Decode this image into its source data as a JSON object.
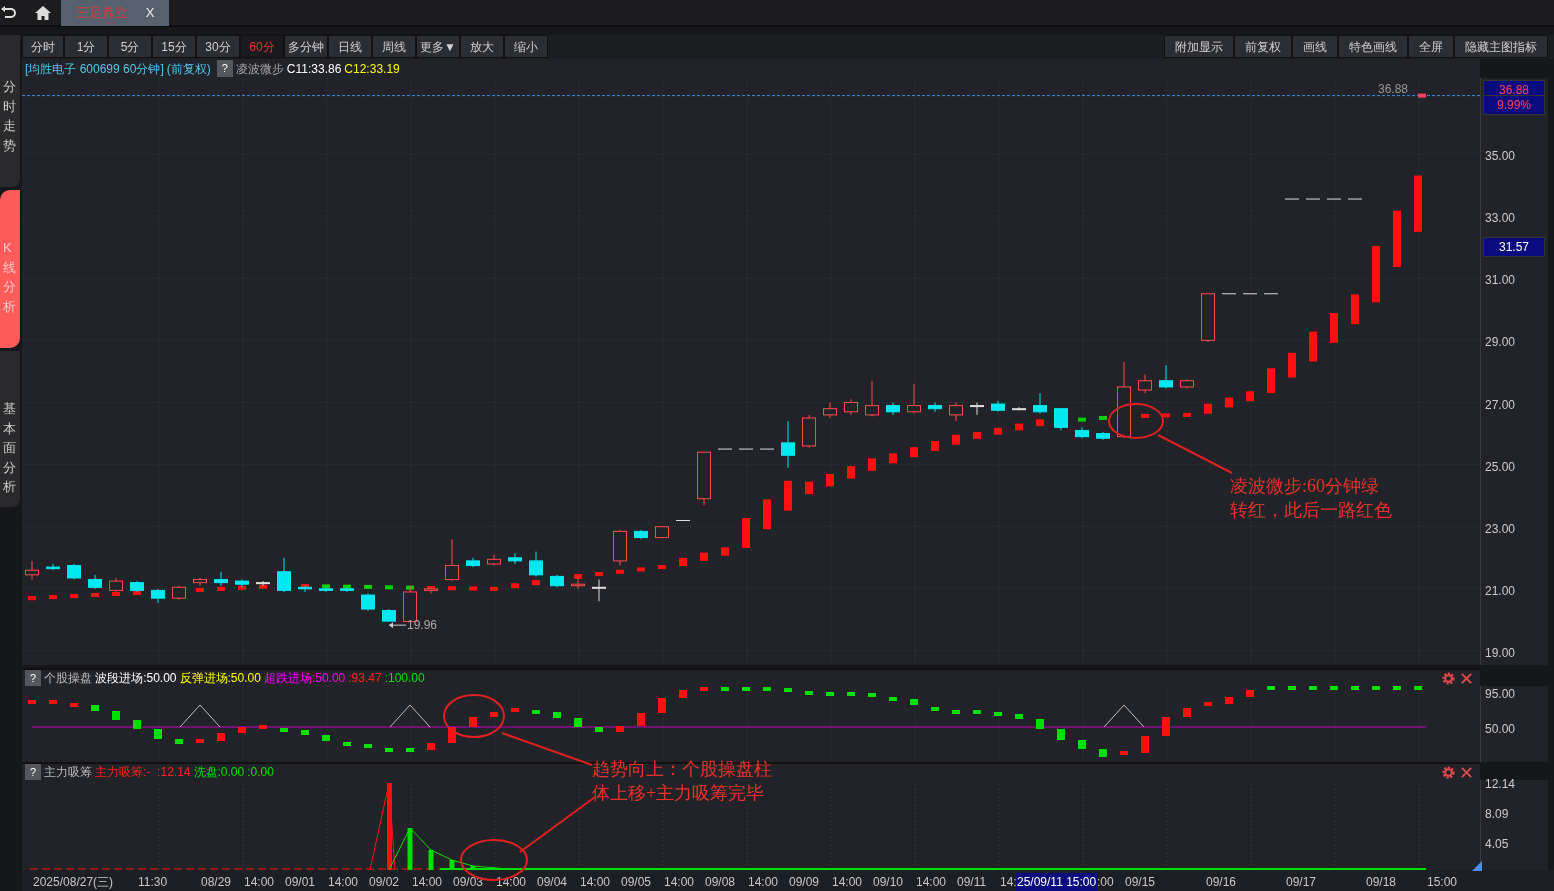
{
  "top_bar": {
    "tabs": [
      {
        "label": "三足鼎立",
        "close": "X",
        "selected": true
      }
    ]
  },
  "sidebar": {
    "items": [
      {
        "label": "分时走势",
        "selected": false
      },
      {
        "label": "K线分析",
        "selected": true
      },
      {
        "label": "基本面分析",
        "selected": false
      }
    ]
  },
  "toolbar": {
    "buttons": [
      {
        "label": "分时",
        "selected": false
      },
      {
        "label": "1分",
        "selected": false
      },
      {
        "label": "5分",
        "selected": false
      },
      {
        "label": "15分",
        "selected": false
      },
      {
        "label": "30分",
        "selected": false
      },
      {
        "label": "60分",
        "selected": true
      },
      {
        "label": "多分钟",
        "selected": false
      },
      {
        "label": "日线",
        "selected": false
      },
      {
        "label": "周线",
        "selected": false
      },
      {
        "label": "更多▼",
        "selected": false
      },
      {
        "label": "放大",
        "selected": false
      },
      {
        "label": "缩小",
        "selected": false
      }
    ],
    "right_buttons": [
      "附加显示",
      "前复权",
      "画线",
      "特色画线",
      "全屏",
      "隐藏主图指标"
    ]
  },
  "info": {
    "title": "[均胜电子 600699 60分钟]",
    "adjust": "(前复权)",
    "help": "?",
    "indicator": "凌波微步",
    "values": [
      {
        "text": "C11:33.86",
        "color": "#ffffff"
      },
      {
        "text": "C12:33.19",
        "color": "#ffff00"
      }
    ]
  },
  "main_chart": {
    "price_line_label": "36.88",
    "low_label": "19.96",
    "price_axis": [
      {
        "text": "36.88",
        "kind": "limit"
      },
      {
        "text": "9.99%",
        "kind": "limit"
      },
      {
        "text": "35.00",
        "kind": "tick"
      },
      {
        "text": "33.00",
        "kind": "tick"
      },
      {
        "text": "31.57",
        "kind": "cursor"
      },
      {
        "text": "31.00",
        "kind": "tick"
      },
      {
        "text": "29.00",
        "kind": "tick"
      },
      {
        "text": "27.00",
        "kind": "tick"
      },
      {
        "text": "25.00",
        "kind": "tick"
      },
      {
        "text": "23.00",
        "kind": "tick"
      },
      {
        "text": "21.00",
        "kind": "tick"
      },
      {
        "text": "19.00",
        "kind": "tick"
      }
    ],
    "annotation": [
      "凌波微步:60分钟绿",
      "转红，此后一路红色"
    ]
  },
  "panels": [
    {
      "help": "?",
      "name": "个股操盘",
      "values": [
        {
          "text": "波段进场:50.00",
          "color": "#ffffff"
        },
        {
          "text": "反弹进场:50.00",
          "color": "#ffff00"
        },
        {
          "text": "超跌进场:50.00",
          "color": "#ff00ff"
        },
        {
          "text": ":93.47",
          "color": "#ff2020"
        },
        {
          "text": ":100.00",
          "color": "#00e000"
        }
      ],
      "axis": [
        "95.00",
        "50.00"
      ]
    },
    {
      "help": "?",
      "name": "主力吸筹",
      "values": [
        {
          "text": "主力吸筹:-  :12.14",
          "color": "#ff2020"
        },
        {
          "text": "洗盘:0.00",
          "color": "#00e000"
        },
        {
          "text": ":0.00",
          "color": "#00e000"
        }
      ],
      "axis": [
        "12.14",
        "8.09",
        "4.05"
      ]
    }
  ],
  "panel_annotation": [
    "趋势向上：个股操盘柱",
    "体上移+主力吸筹完毕"
  ],
  "time_axis": [
    {
      "text": "2025/08/27(三)",
      "kind": "tick"
    },
    {
      "text": "11:30",
      "kind": "tick"
    },
    {
      "text": "08/29",
      "kind": "tick"
    },
    {
      "text": "14:00",
      "kind": "tick"
    },
    {
      "text": "09/01",
      "kind": "tick"
    },
    {
      "text": "14:00",
      "kind": "tick"
    },
    {
      "text": "09/02",
      "kind": "tick"
    },
    {
      "text": "14:00",
      "kind": "tick"
    },
    {
      "text": "09/03",
      "kind": "tick"
    },
    {
      "text": "14:00",
      "kind": "tick"
    },
    {
      "text": "09/04",
      "kind": "tick"
    },
    {
      "text": "14:00",
      "kind": "tick"
    },
    {
      "text": "09/05",
      "kind": "tick"
    },
    {
      "text": "14:00",
      "kind": "tick"
    },
    {
      "text": "09/08",
      "kind": "tick"
    },
    {
      "text": "14:00",
      "kind": "tick"
    },
    {
      "text": "09/09",
      "kind": "tick"
    },
    {
      "text": "14:00",
      "kind": "tick"
    },
    {
      "text": "09/10",
      "kind": "tick"
    },
    {
      "text": "14:00",
      "kind": "tick"
    },
    {
      "text": "09/11",
      "kind": "tick"
    },
    {
      "text": "14:",
      "kind": "tick"
    },
    {
      "text": "25/09/11 15:00",
      "kind": "cursor"
    },
    {
      "text": ":00",
      "kind": "tick"
    },
    {
      "text": "09/15",
      "kind": "tick"
    },
    {
      "text": "09/16",
      "kind": "tick"
    },
    {
      "text": "09/17",
      "kind": "tick"
    },
    {
      "text": "09/18",
      "kind": "tick"
    },
    {
      "text": "15:00",
      "kind": "tick"
    }
  ]
}
